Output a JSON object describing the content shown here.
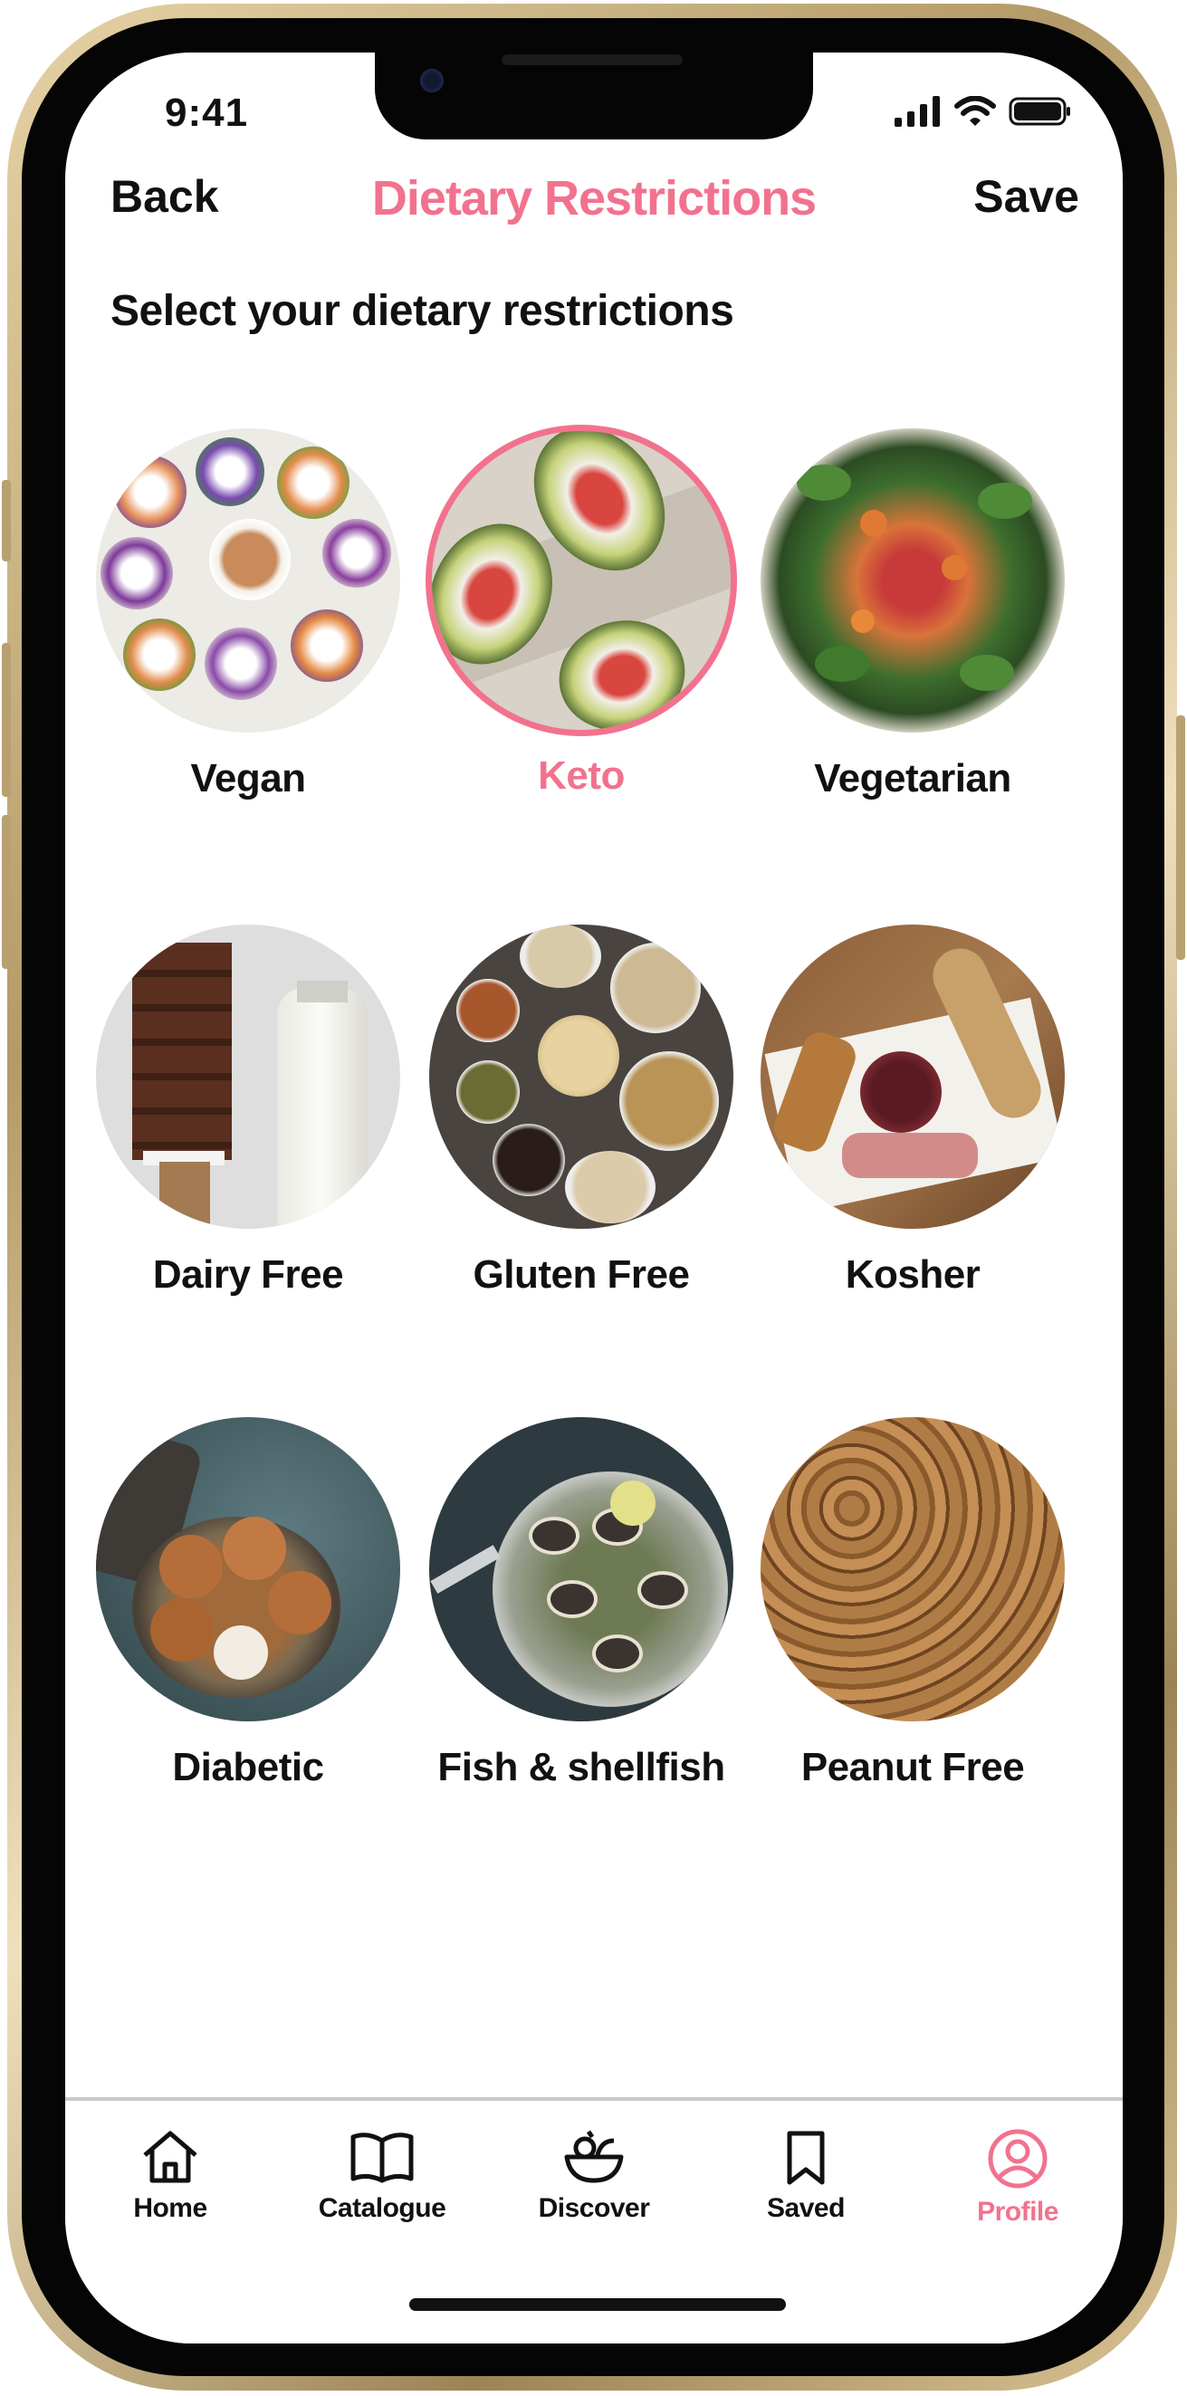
{
  "status": {
    "time": "9:41"
  },
  "nav": {
    "back": "Back",
    "title": "Dietary Restrictions",
    "save": "Save"
  },
  "subtitle": "Select your dietary restrictions",
  "accent": "#f2728e",
  "options": [
    {
      "label": "Vegan",
      "selected": false,
      "icon": "spring-rolls-image"
    },
    {
      "label": "Keto",
      "selected": true,
      "icon": "stuffed-avocado-image"
    },
    {
      "label": "Vegetarian",
      "selected": false,
      "icon": "salad-image"
    },
    {
      "label": "Dairy Free",
      "selected": false,
      "icon": "brownies-milk-image"
    },
    {
      "label": "Gluten Free",
      "selected": false,
      "icon": "grains-nuts-image"
    },
    {
      "label": "Kosher",
      "selected": false,
      "icon": "charcuterie-image"
    },
    {
      "label": "Diabetic",
      "selected": false,
      "icon": "cookies-image"
    },
    {
      "label": "Fish & shellfish",
      "selected": false,
      "icon": "clams-image"
    },
    {
      "label": "Peanut Free",
      "selected": false,
      "icon": "peanuts-image"
    }
  ],
  "tabs": [
    {
      "label": "Home",
      "icon": "home-icon",
      "active": false
    },
    {
      "label": "Catalogue",
      "icon": "book-icon",
      "active": false
    },
    {
      "label": "Discover",
      "icon": "bowl-icon",
      "active": false
    },
    {
      "label": "Saved",
      "icon": "bookmark-icon",
      "active": false
    },
    {
      "label": "Profile",
      "icon": "profile-icon",
      "active": true
    }
  ]
}
